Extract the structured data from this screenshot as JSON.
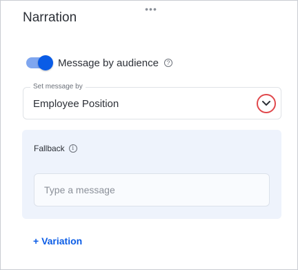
{
  "panel": {
    "title": "Narration",
    "drag_handle_glyph": "•••",
    "drag_handle_icon": "more-horizontal-icon"
  },
  "audience_toggle": {
    "label": "Message by audience",
    "state": "on",
    "help_icon": "question-circle-icon",
    "help_glyph": "?"
  },
  "set_message_by": {
    "legend": "Set message by",
    "value": "Employee Position",
    "dropdown_icon": "chevron-down-icon"
  },
  "fallback": {
    "label": "Fallback",
    "info_icon": "info-circle-icon",
    "info_glyph": "i",
    "input_value": "",
    "input_placeholder": "Type a message"
  },
  "actions": {
    "add_variation_label": "+ Variation"
  },
  "colors": {
    "accent": "#0a5ce6",
    "toggle_track": "#7fa6ef",
    "highlight_ring": "#e0474b",
    "card_background": "#eef3fc"
  }
}
